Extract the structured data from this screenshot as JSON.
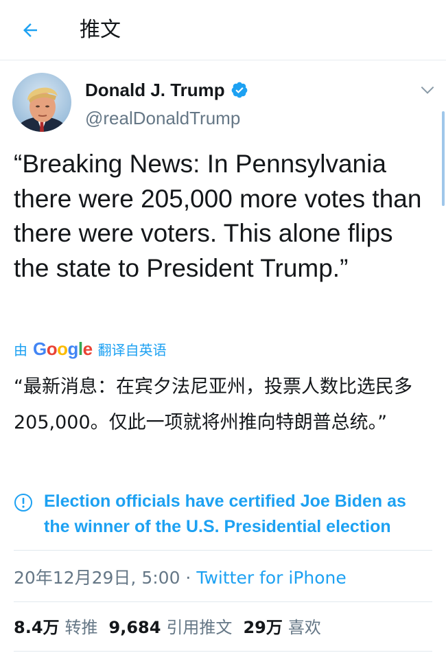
{
  "header": {
    "title": "推文",
    "back_icon": "arrow-left-icon"
  },
  "author": {
    "name": "Donald J. Trump",
    "handle": "@realDonaldTrump",
    "verified": true
  },
  "tweet": {
    "text": "“Breaking News: In Pennsylvania there were 205,000 more votes than there were voters. This alone flips the state to President Trump.”"
  },
  "translation": {
    "prefix": "由",
    "provider": "Google",
    "suffix": "翻译自英语",
    "text": "“最新消息：在宾夕法尼亚州，投票人数比选民多205,000。仅此一项就将州推向特朗普总统。”"
  },
  "notice": {
    "text": "Election officials have certified Joe Biden as the winner of the U.S. Presidential election",
    "icon": "info-icon"
  },
  "meta": {
    "datetime": "20年12月29日, 5:00",
    "separator": " · ",
    "source": "Twitter for iPhone"
  },
  "stats": {
    "retweets_count": "8.4万",
    "retweets_label": "转推",
    "quotes_count": "9,684",
    "quotes_label": "引用推文",
    "likes_count": "29万",
    "likes_label": "喜欢"
  },
  "colors": {
    "accent": "#1da1f2",
    "secondary_text": "#657786",
    "primary_text": "#14171a"
  }
}
